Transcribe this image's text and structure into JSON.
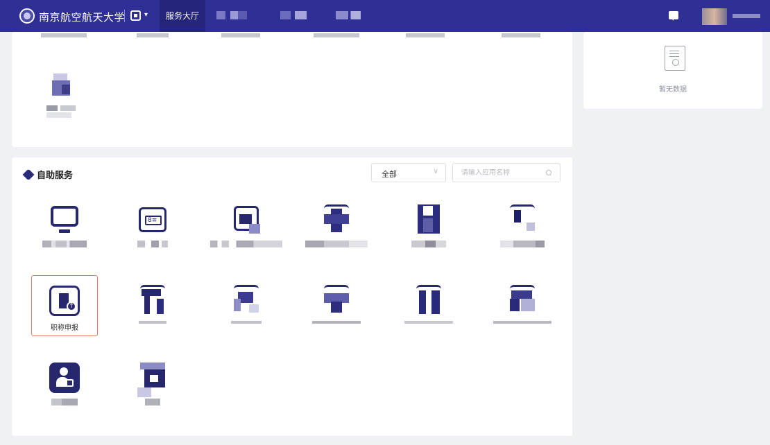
{
  "header": {
    "school_name": "南京航空航天大学",
    "nav_active": "服务大厅",
    "colors": {
      "bar": "#2f2f95",
      "accent": "#27276e",
      "highlight": "#e07a6a"
    }
  },
  "right_panel": {
    "empty_text": "暂无数据"
  },
  "self_service": {
    "title": "自助服务",
    "filter_selected": "全部",
    "search_placeholder": "请输入应用名称",
    "tiles": [
      {
        "label": "",
        "icon": "monitor-icon"
      },
      {
        "label": "",
        "icon": "id-card-icon"
      },
      {
        "label": "",
        "icon": "blurred-icon"
      },
      {
        "label": "",
        "icon": "blurred-icon"
      },
      {
        "label": "",
        "icon": "blurred-icon"
      },
      {
        "label": "",
        "icon": "blurred-icon"
      },
      {
        "label": "职称申报",
        "icon": "document-upload-icon"
      },
      {
        "label": "",
        "icon": "blurred-icon"
      },
      {
        "label": "",
        "icon": "blurred-icon"
      },
      {
        "label": "",
        "icon": "blurred-icon"
      },
      {
        "label": "",
        "icon": "blurred-icon"
      },
      {
        "label": "",
        "icon": "blurred-icon"
      },
      {
        "label": "",
        "icon": "person-card-icon"
      },
      {
        "label": "",
        "icon": "blurred-icon"
      }
    ]
  }
}
